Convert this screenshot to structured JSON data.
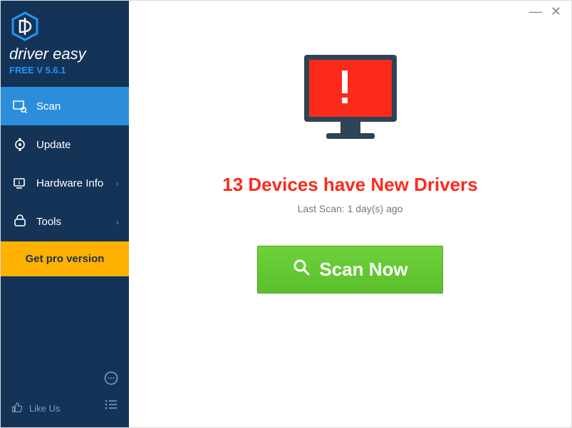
{
  "brand": {
    "name": "driver easy",
    "version": "FREE V 5.6.1"
  },
  "sidebar": {
    "items": [
      {
        "label": "Scan"
      },
      {
        "label": "Update"
      },
      {
        "label": "Hardware Info"
      },
      {
        "label": "Tools"
      }
    ],
    "pro": "Get pro version",
    "like": "Like Us"
  },
  "main": {
    "headline": "13 Devices have New Drivers",
    "last_scan": "Last Scan: 1 day(s) ago",
    "scan_button": "Scan Now"
  }
}
